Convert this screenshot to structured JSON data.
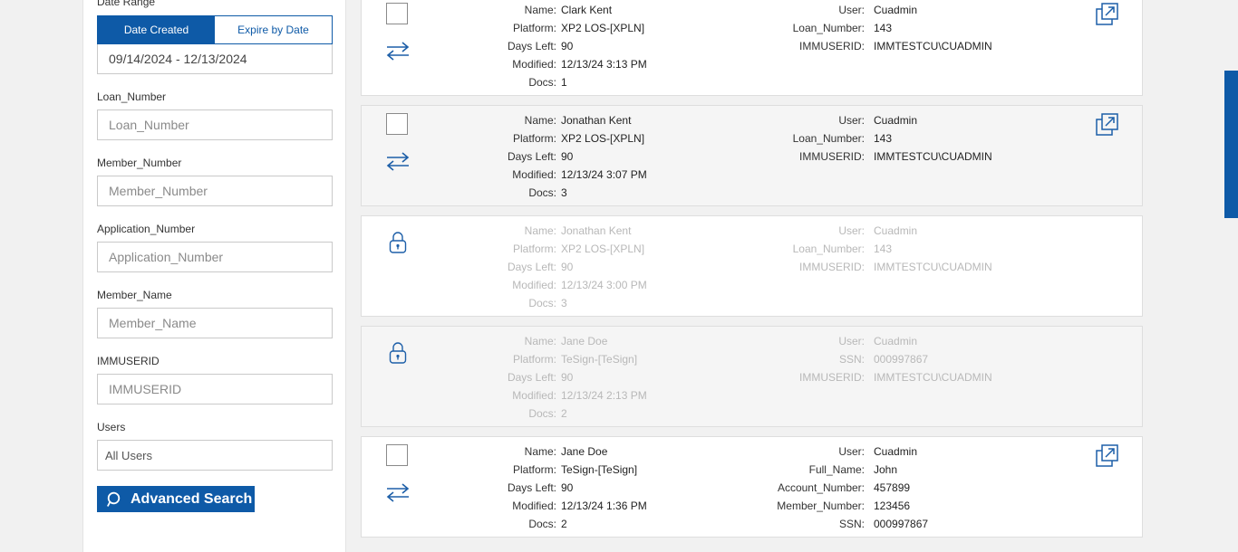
{
  "filters": {
    "date_range_label": "Date Range",
    "tab_created": "Date Created",
    "tab_expire": "Expire by Date",
    "date_range_value": "09/14/2024 - 12/13/2024",
    "loan_number_label": "Loan_Number",
    "loan_number_placeholder": "Loan_Number",
    "member_number_label": "Member_Number",
    "member_number_placeholder": "Member_Number",
    "application_number_label": "Application_Number",
    "application_number_placeholder": "Application_Number",
    "member_name_label": "Member_Name",
    "member_name_placeholder": "Member_Name",
    "immuserid_label": "IMMUSERID",
    "immuserid_placeholder": "IMMUSERID",
    "users_label": "Users",
    "users_value": "All Users",
    "advanced_search": "Advanced Search"
  },
  "results": [
    {
      "locked": false,
      "left": [
        {
          "k": "Name:",
          "v": "Clark Kent"
        },
        {
          "k": "Platform:",
          "v": "XP2 LOS-[XPLN]"
        },
        {
          "k": "Days Left:",
          "v": "90"
        },
        {
          "k": "Modified:",
          "v": "12/13/24 3:13 PM"
        },
        {
          "k": "Docs:",
          "v": "1"
        }
      ],
      "right": [
        {
          "k": "User:",
          "v": "Cuadmin"
        },
        {
          "k": "Loan_Number:",
          "v": "143"
        },
        {
          "k": "IMMUSERID:",
          "v": "IMMTESTCU\\CUADMIN"
        }
      ]
    },
    {
      "locked": false,
      "left": [
        {
          "k": "Name:",
          "v": "Jonathan Kent"
        },
        {
          "k": "Platform:",
          "v": "XP2 LOS-[XPLN]"
        },
        {
          "k": "Days Left:",
          "v": "90"
        },
        {
          "k": "Modified:",
          "v": "12/13/24 3:07 PM"
        },
        {
          "k": "Docs:",
          "v": "3"
        }
      ],
      "right": [
        {
          "k": "User:",
          "v": "Cuadmin"
        },
        {
          "k": "Loan_Number:",
          "v": "143"
        },
        {
          "k": "IMMUSERID:",
          "v": "IMMTESTCU\\CUADMIN"
        }
      ]
    },
    {
      "locked": true,
      "left": [
        {
          "k": "Name:",
          "v": "Jonathan Kent"
        },
        {
          "k": "Platform:",
          "v": "XP2 LOS-[XPLN]"
        },
        {
          "k": "Days Left:",
          "v": "90"
        },
        {
          "k": "Modified:",
          "v": "12/13/24 3:00 PM"
        },
        {
          "k": "Docs:",
          "v": "3"
        }
      ],
      "right": [
        {
          "k": "User:",
          "v": "Cuadmin"
        },
        {
          "k": "Loan_Number:",
          "v": "143"
        },
        {
          "k": "IMMUSERID:",
          "v": "IMMTESTCU\\CUADMIN"
        }
      ]
    },
    {
      "locked": true,
      "left": [
        {
          "k": "Name:",
          "v": "Jane Doe"
        },
        {
          "k": "Platform:",
          "v": "TeSign-[TeSign]"
        },
        {
          "k": "Days Left:",
          "v": "90"
        },
        {
          "k": "Modified:",
          "v": "12/13/24 2:13 PM"
        },
        {
          "k": "Docs:",
          "v": "2"
        }
      ],
      "right": [
        {
          "k": "User:",
          "v": "Cuadmin"
        },
        {
          "k": "SSN:",
          "v": "000997867"
        },
        {
          "k": "IMMUSERID:",
          "v": "IMMTESTCU\\CUADMIN"
        }
      ]
    },
    {
      "locked": false,
      "left": [
        {
          "k": "Name:",
          "v": "Jane Doe"
        },
        {
          "k": "Platform:",
          "v": "TeSign-[TeSign]"
        },
        {
          "k": "Days Left:",
          "v": "90"
        },
        {
          "k": "Modified:",
          "v": "12/13/24 1:36 PM"
        },
        {
          "k": "Docs:",
          "v": "2"
        }
      ],
      "right": [
        {
          "k": "User:",
          "v": "Cuadmin"
        },
        {
          "k": "Full_Name:",
          "v": "John"
        },
        {
          "k": "Account_Number:",
          "v": "457899"
        },
        {
          "k": "Member_Number:",
          "v": "123456"
        },
        {
          "k": "SSN:",
          "v": "000997867"
        }
      ]
    }
  ]
}
